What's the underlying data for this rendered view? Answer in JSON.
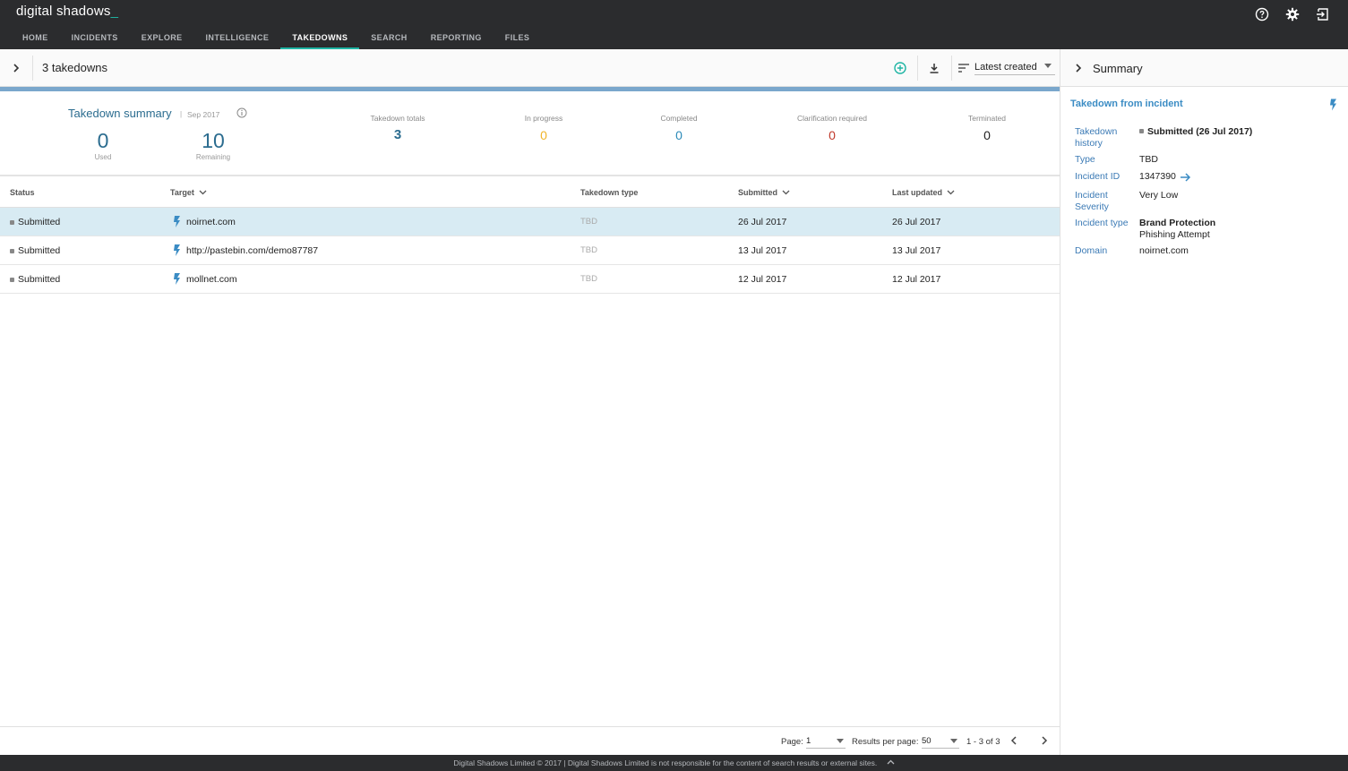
{
  "app": {
    "logo_text": "digital shadows",
    "logo_cursor": "_"
  },
  "nav": {
    "items": [
      {
        "label": "HOME"
      },
      {
        "label": "INCIDENTS"
      },
      {
        "label": "EXPLORE"
      },
      {
        "label": "INTELLIGENCE"
      },
      {
        "label": "TAKEDOWNS",
        "active": true
      },
      {
        "label": "SEARCH"
      },
      {
        "label": "REPORTING"
      },
      {
        "label": "FILES"
      }
    ]
  },
  "toolbar": {
    "count_label": "3 takedowns",
    "sort_label": "Latest created"
  },
  "summary": {
    "title": "Takedown summary",
    "separator": "|",
    "date": "Sep 2017",
    "used_value": "0",
    "used_label": "Used",
    "remaining_value": "10",
    "remaining_label": "Remaining",
    "stats": [
      {
        "label": "Takedown totals",
        "value": "3",
        "color": "#2b6c8f"
      },
      {
        "label": "In progress",
        "value": "0",
        "color": "#f0b429"
      },
      {
        "label": "Completed",
        "value": "0",
        "color": "#2b8ab8"
      },
      {
        "label": "Clarification required",
        "value": "0",
        "color": "#c0392b"
      },
      {
        "label": "Terminated",
        "value": "0",
        "color": "#222222"
      }
    ]
  },
  "table": {
    "headers": {
      "status": "Status",
      "target": "Target",
      "type": "Takedown type",
      "submitted": "Submitted",
      "updated": "Last updated"
    },
    "rows": [
      {
        "status": "Submitted",
        "target": "noirnet.com",
        "type": "TBD",
        "submitted": "26 Jul 2017",
        "updated": "26 Jul 2017"
      },
      {
        "status": "Submitted",
        "target": "http://pastebin.com/demo87787",
        "type": "TBD",
        "submitted": "13 Jul 2017",
        "updated": "13 Jul 2017"
      },
      {
        "status": "Submitted",
        "target": "mollnet.com",
        "type": "TBD",
        "submitted": "12 Jul 2017",
        "updated": "12 Jul 2017"
      }
    ]
  },
  "panel": {
    "title": "Summary",
    "subtitle": "Takedown from incident",
    "history_key": "Takedown history",
    "history_value": "Submitted (26 Jul 2017)",
    "type_key": "Type",
    "type_value": "TBD",
    "incident_id_key": "Incident ID",
    "incident_id_value": "1347390",
    "severity_key": "Incident Severity",
    "severity_value": "Very Low",
    "incident_type_key": "Incident type",
    "incident_type_value_1": "Brand Protection",
    "incident_type_value_2": "Phishing Attempt",
    "domain_key": "Domain",
    "domain_value": "noirnet.com"
  },
  "pager": {
    "page_label": "Page:",
    "page_value": "1",
    "per_page_label": "Results per page:",
    "per_page_value": "50",
    "range": "1 - 3 of 3"
  },
  "footer": {
    "text": "Digital Shadows Limited © 2017 | Digital Shadows Limited is not responsible for the content of search results or external sites."
  },
  "colors": {
    "accent": "#1fb5a4",
    "header_bg": "#2b2c2e",
    "link_blue": "#3b8cc4",
    "selected_row": "#d8ebf3"
  },
  "icons": [
    "help-icon",
    "settings-icon",
    "logout-icon",
    "add-icon",
    "download-icon",
    "sort-icon",
    "chevron-right-icon",
    "bolt-icon",
    "arrow-right-icon",
    "info-icon",
    "chevron-up-icon"
  ]
}
